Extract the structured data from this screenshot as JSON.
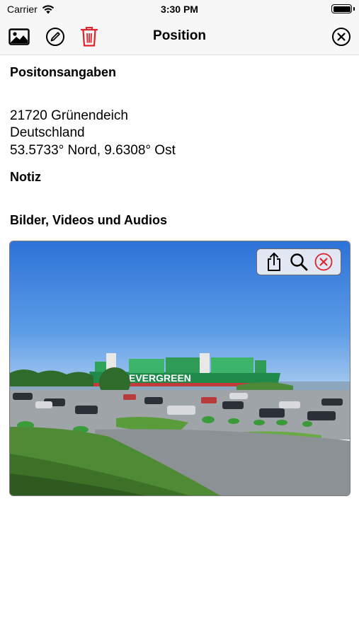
{
  "status_bar": {
    "carrier": "Carrier",
    "time": "3:30 PM",
    "battery_level": 1.0
  },
  "nav_bar": {
    "title": "Position",
    "left_icons": [
      "photo-library-icon",
      "edit-icon",
      "trash-icon"
    ],
    "right_icon": "close-icon"
  },
  "content": {
    "position_heading": "Positonsangaben",
    "address_line1": "21720 Grünendeich",
    "address_line2": "Deutschland",
    "coordinates": "53.5733° Nord, 9.6308° Ost",
    "note_heading": "Notiz",
    "media_heading": "Bilder, Videos und Audios"
  },
  "media": {
    "items": [
      {
        "type": "photo",
        "description_icon": "photo-thumbnail",
        "ship_lettering": "EVERGREEN"
      }
    ],
    "toolbar": [
      "share-icon",
      "zoom-icon",
      "delete-icon"
    ]
  },
  "colors": {
    "destructive": "#e0232b",
    "bar_background": "#f7f7f7"
  }
}
